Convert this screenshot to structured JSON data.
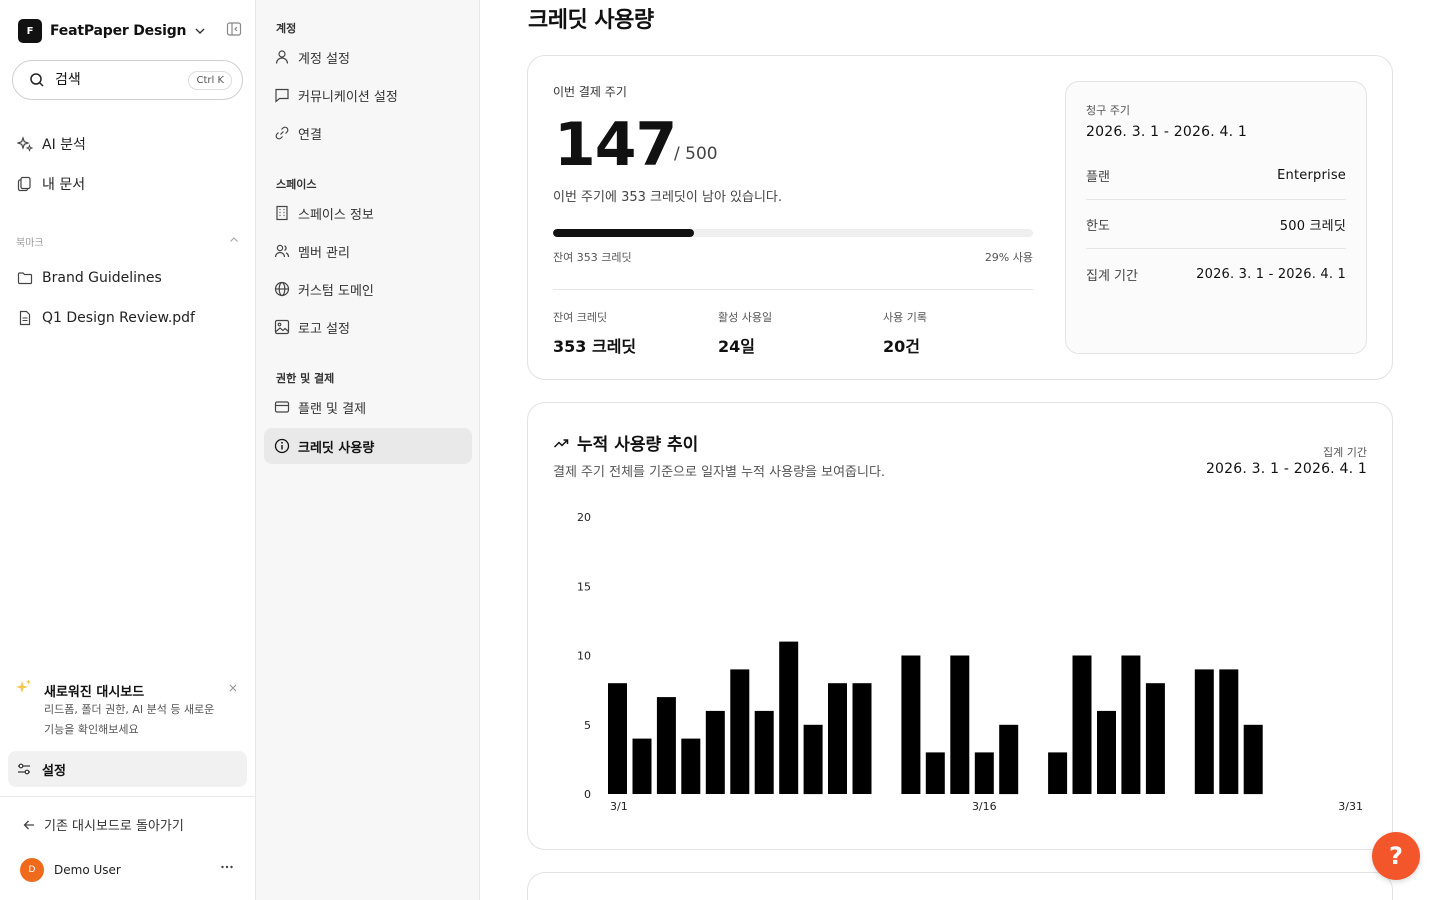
{
  "workspace": {
    "logo_letter": "F",
    "name": "FeatPaper Design"
  },
  "search": {
    "placeholder": "검색",
    "shortcut": "Ctrl K"
  },
  "sidebar": {
    "nav": [
      {
        "label": "AI 분석",
        "icon": "sparkles-icon"
      },
      {
        "label": "내 문서",
        "icon": "documents-icon"
      }
    ],
    "bookmarks_title": "북마크",
    "bookmarks": [
      {
        "label": "Brand Guidelines",
        "icon": "folder-icon"
      },
      {
        "label": "Q1 Design Review.pdf",
        "icon": "file-icon"
      }
    ],
    "promo": {
      "title": "새로워진 대시보드",
      "description": "리드폼, 폴더 권한, AI 분석 등 새로운 기능을 확인해보세요"
    },
    "settings_label": "설정",
    "back_label": "기존 대시보드로 돌아가기",
    "user": {
      "initial": "D",
      "name": "Demo User",
      "avatar_color": "#f06a1c"
    }
  },
  "settings_nav": {
    "sections": [
      {
        "title": "계정",
        "items": [
          {
            "label": "계정 설정",
            "icon": "user-icon"
          },
          {
            "label": "커뮤니케이션 설정",
            "icon": "message-icon"
          },
          {
            "label": "연결",
            "icon": "link-icon"
          }
        ]
      },
      {
        "title": "스페이스",
        "items": [
          {
            "label": "스페이스 정보",
            "icon": "building-icon"
          },
          {
            "label": "멤버 관리",
            "icon": "users-icon"
          },
          {
            "label": "커스텀 도메인",
            "icon": "globe-icon"
          },
          {
            "label": "로고 설정",
            "icon": "image-icon"
          }
        ]
      },
      {
        "title": "권한 및 결제",
        "items": [
          {
            "label": "플랜 및 결제",
            "icon": "credit-card-icon"
          },
          {
            "label": "크레딧 사용량",
            "icon": "info-icon",
            "active": true
          }
        ]
      }
    ]
  },
  "page": {
    "title": "크레딧 사용량"
  },
  "usage": {
    "label": "이번 결제 주기",
    "used": "147",
    "total": "/ 500",
    "remaining_text": "이번 주기에 353 크레딧이 남아 있습니다.",
    "used_fraction": 0.294,
    "bar_left": "잔여 353 크레딧",
    "bar_right": "29% 사용",
    "stats": [
      {
        "label": "잔여 크레딧",
        "value": "353 크레딧"
      },
      {
        "label": "활성 사용일",
        "value": "24일"
      },
      {
        "label": "사용 기록",
        "value": "20건"
      }
    ]
  },
  "billing": {
    "cycle_label": "청구 주기",
    "cycle_value": "2026. 3. 1 - 2026. 4. 1",
    "rows": [
      {
        "label": "플랜",
        "value": "Enterprise"
      },
      {
        "label": "한도",
        "value": "500 크레딧"
      },
      {
        "label": "집계 기간",
        "value": "2026. 3. 1 - 2026. 4. 1"
      }
    ]
  },
  "trend": {
    "title": "누적 사용량 추이",
    "subtitle": "결제 주기 전체를 기준으로 일자별 누적 사용량을 보여줍니다.",
    "period_label": "집계 기간",
    "period_value": "2026. 3. 1 - 2026. 4. 1"
  },
  "chart_data": {
    "type": "bar",
    "categories": [
      "3/1",
      "3/2",
      "3/3",
      "3/4",
      "3/5",
      "3/6",
      "3/7",
      "3/8",
      "3/9",
      "3/10",
      "3/11",
      "3/12",
      "3/13",
      "3/14",
      "3/15",
      "3/16",
      "3/17",
      "3/18",
      "3/19",
      "3/20",
      "3/21",
      "3/22",
      "3/23",
      "3/24",
      "3/25",
      "3/26",
      "3/27",
      "3/28",
      "3/29",
      "3/30",
      "3/31"
    ],
    "values": [
      8,
      4,
      7,
      4,
      6,
      9,
      6,
      11,
      5,
      8,
      8,
      0,
      10,
      3,
      10,
      3,
      5,
      0,
      3,
      10,
      6,
      10,
      8,
      0,
      9,
      9,
      5,
      0,
      0,
      0,
      0
    ],
    "xtick_labels": [
      "3/1",
      "3/16",
      "3/31"
    ],
    "yticks": [
      0,
      5,
      10,
      15,
      20
    ],
    "ylim": [
      0,
      20
    ],
    "bar_color": "#000000",
    "grid": false
  },
  "help": {
    "label": "?",
    "color": "#f4562c"
  }
}
